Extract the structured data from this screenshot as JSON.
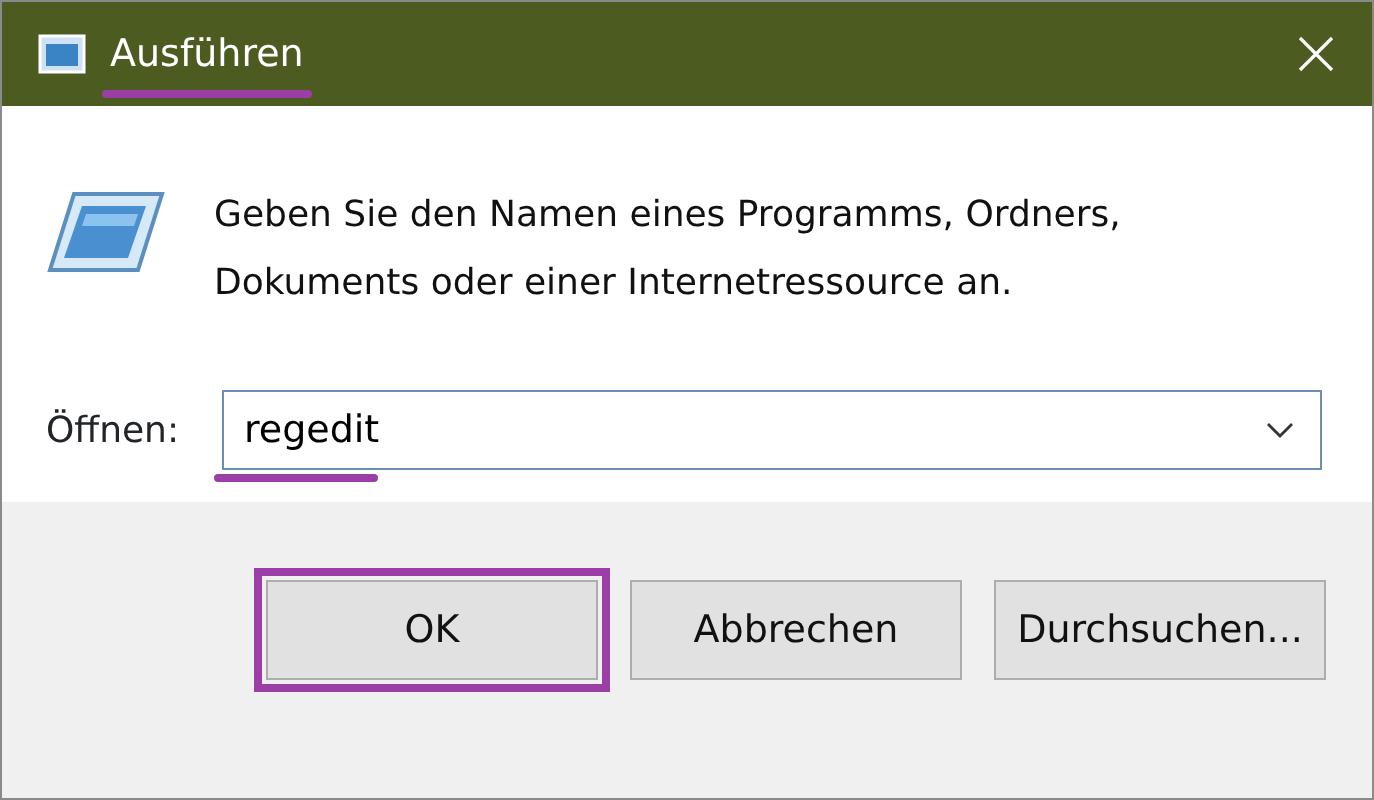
{
  "window": {
    "title": "Ausführen",
    "title_highlighted": true
  },
  "prompt": "Geben Sie den Namen eines Programms, Ordners, Dokuments oder einer Internetressource an.",
  "open_field": {
    "label": "Öffnen:",
    "value": "regedit",
    "value_highlighted": true
  },
  "buttons": [
    {
      "label": "OK",
      "highlighted": true
    },
    {
      "label": "Abbrechen",
      "highlighted": false
    },
    {
      "label": "Durchsuchen...",
      "highlighted": false
    }
  ]
}
